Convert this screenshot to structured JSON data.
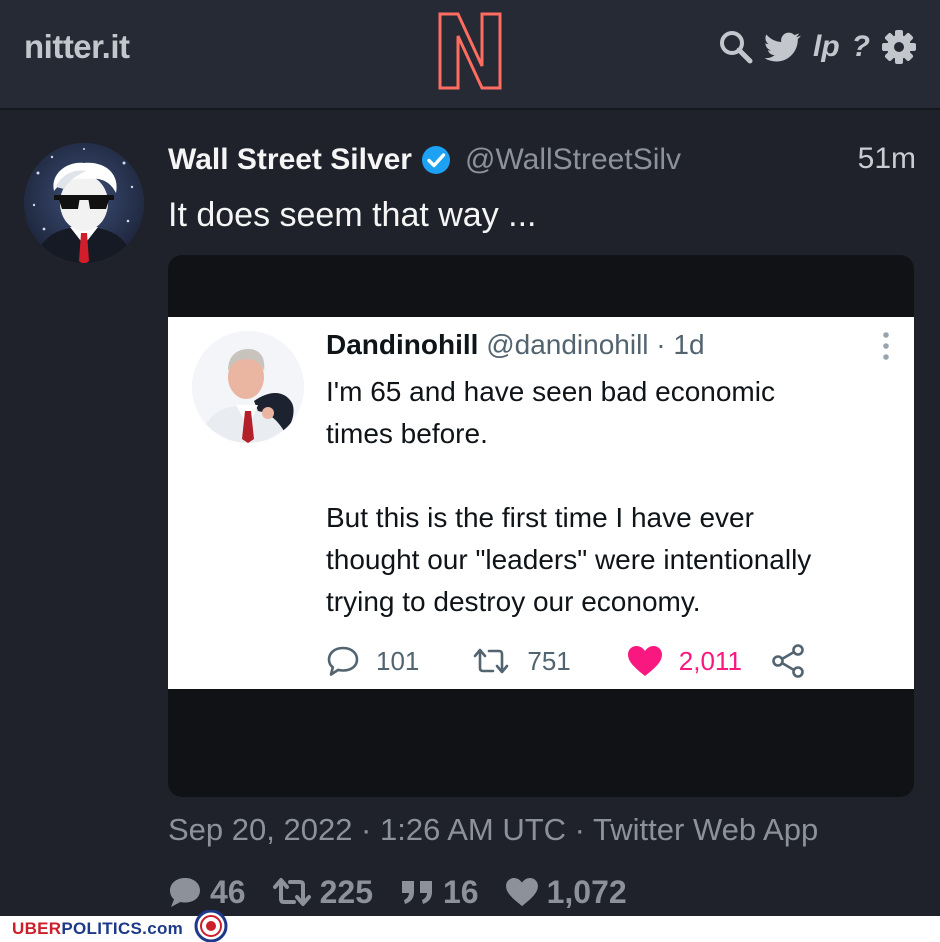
{
  "header": {
    "site_name": "nitter.it",
    "logo_letter": "N",
    "logo_color": "#ff6c60",
    "nav_icons": [
      "search-icon",
      "twitter-bird-icon",
      "lp-icon",
      "help-icon",
      "gear-icon"
    ],
    "lp_text": "lp",
    "help_text": "?"
  },
  "tweet": {
    "fullname": "Wall Street Silver",
    "username": "@WallStreetSilv",
    "time": "51m",
    "text": "It does seem that way ...",
    "verified_color": "#1da1f2",
    "date_line": "Sep 20, 2022 · 1:26 AM UTC · Twitter Web App",
    "stats": {
      "replies": "46",
      "retweets": "225",
      "quotes": "16",
      "likes": "1,072"
    }
  },
  "embedded_tweet": {
    "name": "Dandinohill",
    "handle_time": " @dandinohill · 1d",
    "lines": [
      "I'm 65 and have seen bad economic",
      "times before.",
      "But this is the first time I have ever",
      "thought our \"leaders\" were intentionally",
      "trying to destroy our economy."
    ],
    "replies": "101",
    "retweets": "751",
    "likes": "2,011",
    "like_color": "#f91880"
  },
  "watermark": {
    "uber": "UBER",
    "politics": "POLITICS.com"
  }
}
